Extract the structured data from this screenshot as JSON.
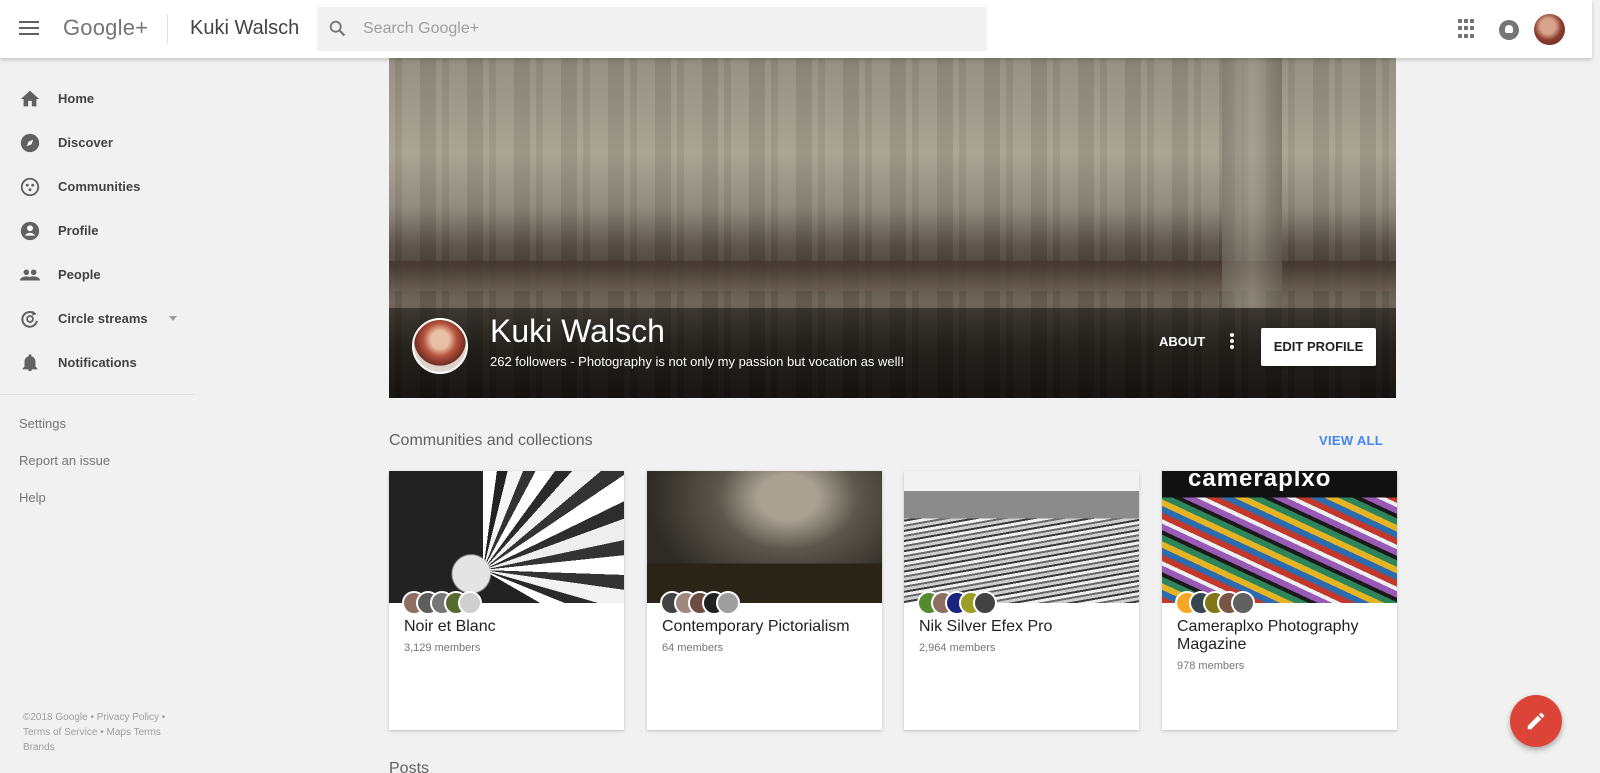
{
  "header": {
    "logo": "Google+",
    "page_name": "Kuki Walsch",
    "search_placeholder": "Search Google+"
  },
  "sidebar": {
    "items": [
      {
        "label": "Home",
        "icon": "home-icon"
      },
      {
        "label": "Discover",
        "icon": "compass-icon"
      },
      {
        "label": "Communities",
        "icon": "communities-icon"
      },
      {
        "label": "Profile",
        "icon": "profile-icon"
      },
      {
        "label": "People",
        "icon": "people-icon"
      },
      {
        "label": "Circle streams",
        "icon": "circle-streams-icon"
      },
      {
        "label": "Notifications",
        "icon": "bell-icon"
      }
    ],
    "links": [
      "Settings",
      "Report an issue",
      "Help"
    ],
    "footer": {
      "copyright": "©2018 Google",
      "privacy": "Privacy Policy",
      "terms": "Terms of Service",
      "maps_terms": "Maps Terms",
      "brands": "Brands"
    }
  },
  "profile": {
    "name": "Kuki Walsch",
    "description": "262 followers - Photography is not only my passion but vocation as well!",
    "about_label": "ABOUT",
    "edit_label": "EDIT PROFILE"
  },
  "collections": {
    "title": "Communities and collections",
    "view_all": "VIEW ALL",
    "cards": [
      {
        "title": "Noir et Blanc",
        "members": "3,129 members"
      },
      {
        "title": "Contemporary Pictorialism",
        "members": "64 members"
      },
      {
        "title": "Nik Silver Efex Pro",
        "members": "2,964 members"
      },
      {
        "title": "Cameraplxo Photography Magazine",
        "members": "978 members",
        "logo_text": "cameraplxo"
      }
    ]
  },
  "posts": {
    "title": "Posts"
  },
  "colors": {
    "accent": "#4285f4",
    "fab": "#db4437"
  }
}
